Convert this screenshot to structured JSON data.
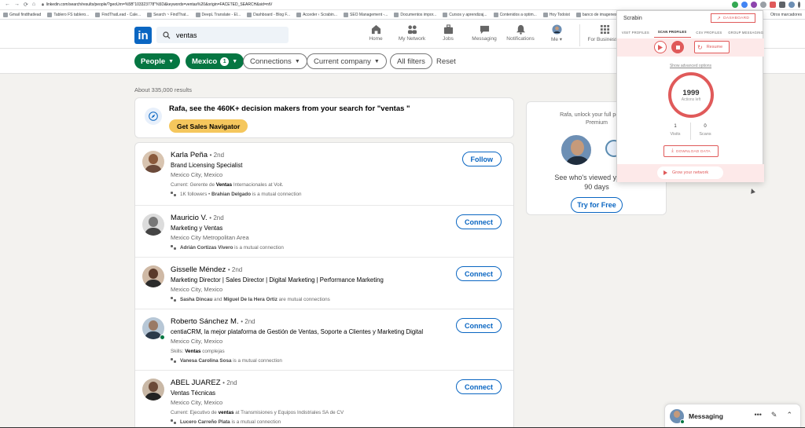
{
  "browser": {
    "url": "linkedin.com/search/results/people/?geoUrn=%5B\"103323778\"%5D&keywords=ventas%20&origin=FACETED_SEARCH&sid=ntV",
    "bookmarks": [
      "Gmail findthatlead",
      "Tablero FS tablero...",
      "FindThatLead - Cale...",
      "Search ~ FindThat...",
      "DeepL Translate - El...",
      "Dashboard - Blog F...",
      "Acceder ‹ Scrabin...",
      "SEO Management -...",
      "Documentos impor...",
      "Cursos y aprendizaj...",
      "Contenidos a optim...",
      "Hoy Todoist",
      "banco de imagenes"
    ],
    "bookmarks_other": "Otros marcadores"
  },
  "header": {
    "search_value": "ventas",
    "nav": [
      {
        "label": "Home",
        "icon": "home-icon"
      },
      {
        "label": "My Network",
        "icon": "network-icon"
      },
      {
        "label": "Jobs",
        "icon": "jobs-icon"
      },
      {
        "label": "Messaging",
        "icon": "messaging-icon"
      },
      {
        "label": "Notifications",
        "icon": "bell-icon"
      },
      {
        "label": "Me ▾",
        "icon": "avatar"
      }
    ],
    "for_business": "For Business ▾"
  },
  "filters": {
    "people": "People",
    "mexico": "Mexico",
    "mexico_count": "1",
    "connections": "Connections",
    "current_company": "Current company",
    "all_filters": "All filters",
    "reset": "Reset"
  },
  "results_count": "About 335,000 results",
  "promo": {
    "title": "Rafa, see the 460K+ decision makers from your search for \"ventas \"",
    "button": "Get Sales Navigator"
  },
  "people": [
    {
      "name": "Karla Peña",
      "degree": "• 2nd",
      "headline": "Brand Licensing Specialist",
      "location": "Mexico City, Mexico",
      "extra_pre": "Current: Gerente de ",
      "extra_bold": "Ventas",
      "extra_post": " Internacionales at Voit.",
      "mutual_pre": "1K followers • ",
      "mutual_bold": "Brahian Delgado",
      "mutual_post": " is a mutual connection",
      "action": "Follow"
    },
    {
      "name": "Mauricio V.",
      "degree": "• 2nd",
      "headline": "Marketing y Ventas",
      "location": "Mexico City Metropolitan Area",
      "extra_pre": "",
      "extra_bold": "",
      "extra_post": "",
      "mutual_pre": "",
      "mutual_bold": "Adrián Cortizas Vivero",
      "mutual_post": " is a mutual connection",
      "action": "Connect"
    },
    {
      "name": "Gisselle Méndez",
      "degree": "• 2nd",
      "headline": "Marketing Director | Sales Director | Digital Marketing | Performance Marketing",
      "location": "Mexico City, Mexico",
      "extra_pre": "",
      "extra_bold": "",
      "extra_post": "",
      "mutual_pre": "",
      "mutual_bold": "Sasha Dincau",
      "mutual_mid": " and ",
      "mutual_bold2": "Miguel De la Hera Ortiz",
      "mutual_post": " are mutual connections",
      "action": "Connect"
    },
    {
      "name": "Roberto Sánchez M.",
      "degree": "• 2nd",
      "headline": "centiaCRM, la mejor plataforma de Gestión de Ventas, Soporte a Clientes y Marketing Digital",
      "location": "Mexico City, Mexico",
      "extra_pre": "Skills: ",
      "extra_bold": "Ventas",
      "extra_post": " complejas",
      "mutual_pre": "",
      "mutual_bold": "Vanesa Carolina Sosa",
      "mutual_post": " is a mutual connection",
      "action": "Connect"
    },
    {
      "name": "ABEL JUAREZ",
      "degree": "• 2nd",
      "headline": "Ventas Técnicas",
      "location": "Mexico City, Mexico",
      "extra_pre": "Current: Ejecutivo de ",
      "extra_bold": "ventas",
      "extra_post": " at Transmisiones y Equipos Indistriales SA de CV",
      "mutual_pre": "",
      "mutual_bold": "Lucero Carreño Plata",
      "mutual_post": " is a mutual connection",
      "action": "Connect"
    }
  ],
  "side": {
    "message_line1": "Rafa, unlock your full potential",
    "message_line2": "Premium",
    "who_line1": "See who's viewed your pro",
    "who_line2": "90 days",
    "button": "Try for Free"
  },
  "scrabin": {
    "title": "Scrabin",
    "dashboard": "DASHBOARD",
    "tabs": [
      "VISIT PROFILES",
      "SCAN PROFILES",
      "CSV PROFILES",
      "GROUP MESSAGING"
    ],
    "active_tab": "SCAN PROFILES",
    "resume": "Resume",
    "advanced": "Show advanced options",
    "actions_value": "1999",
    "actions_label": "Actions left",
    "visits_value": "1",
    "visits_label": "Visits",
    "scans_value": "0",
    "scans_label": "Scans",
    "download": "DOWNLOAD DATA",
    "grow": "Grow your network",
    "accent": "#e05a5a"
  },
  "messaging": {
    "title": "Messaging",
    "icons": [
      "more-icon",
      "compose-icon",
      "chevron-up-icon"
    ]
  }
}
